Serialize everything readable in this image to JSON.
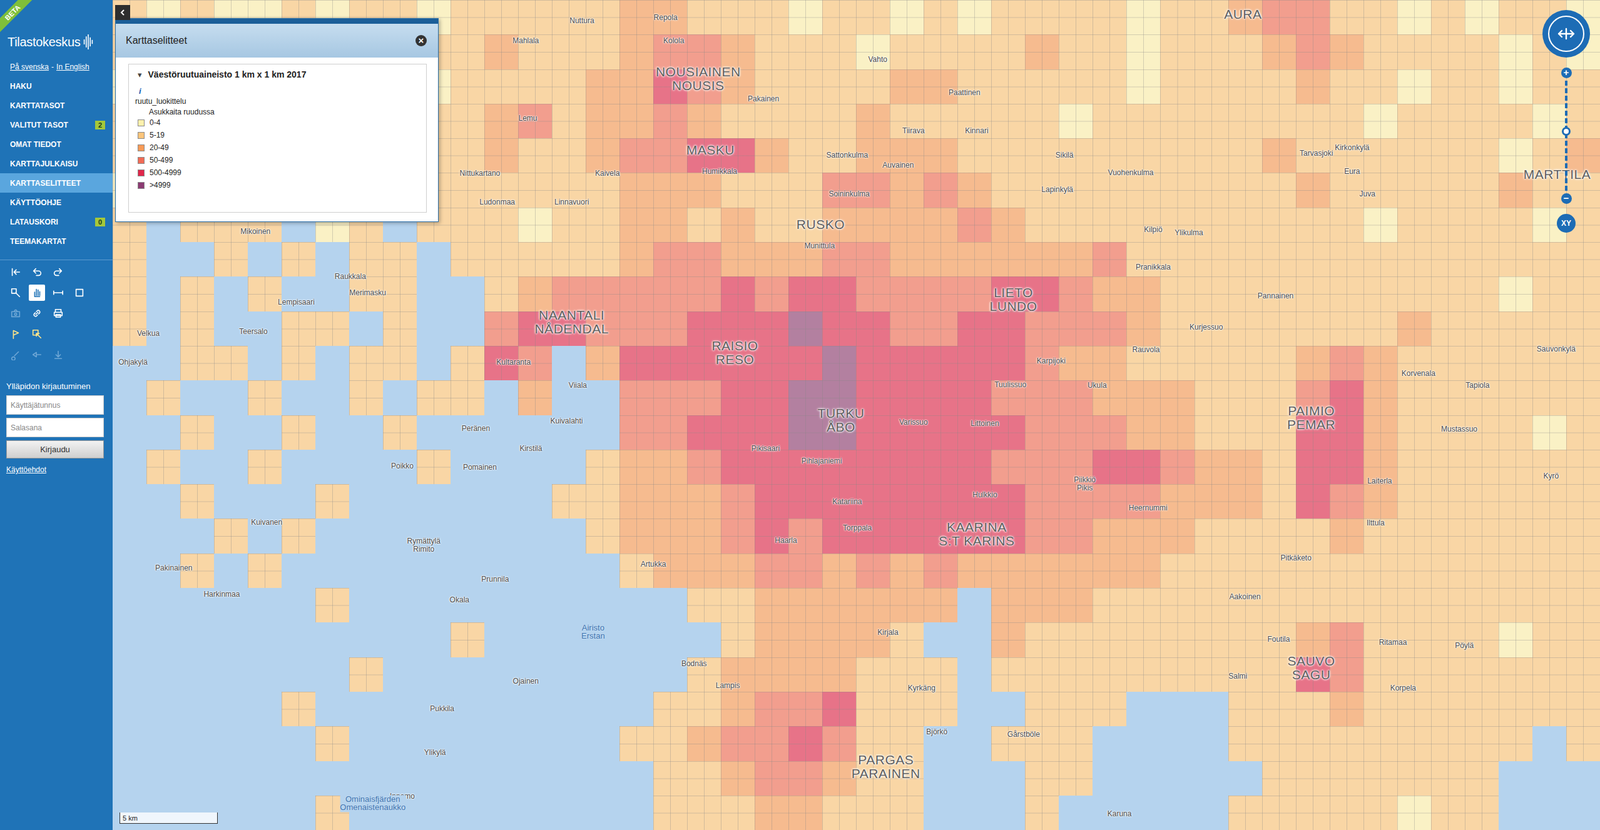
{
  "app": {
    "ribbon": "BETA",
    "logo": "Tilastokeskus"
  },
  "languages": {
    "links": [
      "På svenska",
      "In English"
    ],
    "separator": "-"
  },
  "menu": [
    {
      "label": "HAKU",
      "selected": false
    },
    {
      "label": "KARTTATASOT",
      "selected": false
    },
    {
      "label": "VALITUT TASOT",
      "selected": false,
      "badge": "2"
    },
    {
      "label": "OMAT TIEDOT",
      "selected": false
    },
    {
      "label": "KARTTAJULKAISU",
      "selected": false
    },
    {
      "label": "KARTTASELITTEET",
      "selected": true
    },
    {
      "label": "KÄYTTÖOHJE",
      "selected": false
    },
    {
      "label": "LATAUSKORI",
      "selected": false,
      "badge": "0"
    },
    {
      "label": "TEEMAKARTAT",
      "selected": false
    }
  ],
  "tools": [
    [
      {
        "selected": false,
        "disabled": false
      },
      {
        "selected": false,
        "disabled": false
      },
      {
        "selected": false,
        "disabled": false
      }
    ],
    [
      {
        "selected": false,
        "disabled": false
      },
      {
        "selected": true,
        "disabled": false
      },
      {
        "selected": false,
        "disabled": false
      },
      {
        "selected": false,
        "disabled": false
      }
    ],
    [
      {
        "selected": false,
        "disabled": true
      },
      {
        "selected": false,
        "disabled": false
      },
      {
        "selected": false,
        "disabled": false
      }
    ],
    [
      {
        "selected": false,
        "disabled": false
      },
      {
        "selected": false,
        "disabled": false
      }
    ],
    [
      {
        "selected": false,
        "disabled": true
      },
      {
        "selected": false,
        "disabled": true
      },
      {
        "selected": false,
        "disabled": true
      }
    ]
  ],
  "login": {
    "title": "Ylläpidon kirjautuminen",
    "username_placeholder": "Käyttäjätunnus",
    "password_placeholder": "Salasana",
    "button": "Kirjaudu",
    "terms": "Käyttöehdot"
  },
  "legend_panel": {
    "title": "Karttaselitteet",
    "close": "×",
    "layer": {
      "toggle": "▾",
      "title": "Väestöruutuaineisto 1 km x 1 km 2017",
      "expanded": true,
      "info": "i",
      "field": "ruutu_luokittelu",
      "caption": "Asukkaita ruudussa",
      "classes": [
        {
          "label": "0-4",
          "color": "#fff1ad"
        },
        {
          "label": "5-19",
          "color": "#fdc57a"
        },
        {
          "label": "20-49",
          "color": "#f99a56"
        },
        {
          "label": "50-499",
          "color": "#f26b55"
        },
        {
          "label": "500-4999",
          "color": "#e0264a"
        },
        {
          "label": ">4999",
          "color": "#8c3b72"
        }
      ]
    }
  },
  "grid": {
    "rows": [
      "10100101101111122111011010111101123311010110",
      "11011010111211123321110111121101112321111010",
      "01101101101111224321111221111101111211011011",
      "10110111111231223211112111110111111110111101",
      "11011011111211233442112221111111112111111012",
      "01101~~1111111122211133232111111111211111211",
      "1~111~01~11101122121122223211111111110111101",
      "1~~1~1~11~1111123322233222222311111111111111",
      "1~1~1~~11~~123333343443333443221111111111011",
      "1~1~~11~1~~344333444544334433321111111211111",
      "~~11~1~11~143~244444454444432211111232111111",
      "~1~~1~~1~11~2~~33344554444333222111342111111",
      "~~1~~1~~1~~~~~~33444554444433322111442111101",
      "~1~~1~~~~1~~~~122344444444333443221442111111",
      "~~1~~~1~~~~~~1122234444444433332221432111111",
      "~~~1~1~~~~~~~~122234344444433222111121111111",
      "~~1~1~~~~~~~~~~12223323232222221111111111111",
      "~~~~~~1~~~~~~~~~~11222222~222111111111111111",
      "~~~~~~~~~~1~~~~~~~122221~~211111111231111011",
      "~~~~~~~1~~~~~~~~~12222111~111111111431111111",
      "~~~~~1~~~~~~~~~~112334111~~111~~~11121111111",
      "~~~~~~1~~~~~~~~112334311~~111~~~~111111111~1",
      "~~~~~~~~~~~~~~~~11233211~~~11~~~~~1111111~~~",
      "~~~~~~1~~~~~~~~~11122111~~~1~~~~~11111011~~~"
    ]
  },
  "places": [
    {
      "lines": [
        "NOUSIAINEN",
        "NOUSIS"
      ],
      "kind": "municipality"
    },
    {
      "lines": [
        "MASKU"
      ],
      "kind": "municipality"
    },
    {
      "lines": [
        "RUSKO"
      ],
      "kind": "municipality"
    },
    {
      "lines": [
        "NAANTALI",
        "NÅDENDAL"
      ],
      "kind": "municipality"
    },
    {
      "lines": [
        "RAISIO",
        "RESO"
      ],
      "kind": "municipality"
    },
    {
      "lines": [
        "TURKU",
        "ÅBO"
      ],
      "kind": "municipality"
    },
    {
      "lines": [
        "LIETO",
        "LUNDO"
      ],
      "kind": "municipality"
    },
    {
      "lines": [
        "KAARINA",
        "S:T KARINS"
      ],
      "kind": "municipality"
    },
    {
      "lines": [
        "PAIMIO",
        "PEMAR"
      ],
      "kind": "municipality"
    },
    {
      "lines": [
        "SAUVO",
        "SAGU"
      ],
      "kind": "municipality"
    },
    {
      "lines": [
        "PARGAS",
        "PARAINEN"
      ],
      "kind": "municipality"
    },
    {
      "lines": [
        "AURA"
      ],
      "kind": "municipality"
    },
    {
      "lines": [
        "MARTTILA"
      ],
      "kind": "municipality"
    },
    {
      "lines": [
        "Nuttura"
      ],
      "kind": "village"
    },
    {
      "lines": [
        "Repola"
      ],
      "kind": "village"
    },
    {
      "lines": [
        "Kolola"
      ],
      "kind": "village"
    },
    {
      "lines": [
        "Mahlala"
      ],
      "kind": "village"
    },
    {
      "lines": [
        "Lemu"
      ],
      "kind": "village"
    },
    {
      "lines": [
        "Vahto"
      ],
      "kind": "village"
    },
    {
      "lines": [
        "Pakainen"
      ],
      "kind": "village"
    },
    {
      "lines": [
        "Paattinen"
      ],
      "kind": "village"
    },
    {
      "lines": [
        "Tiirava"
      ],
      "kind": "village"
    },
    {
      "lines": [
        "Kinnari"
      ],
      "kind": "village"
    },
    {
      "lines": [
        "Sattonkulma"
      ],
      "kind": "village"
    },
    {
      "lines": [
        "Auvainen"
      ],
      "kind": "village"
    },
    {
      "lines": [
        "Tarvasjoki"
      ],
      "kind": "village"
    },
    {
      "lines": [
        "Kirkonkylä"
      ],
      "kind": "village"
    },
    {
      "lines": [
        "Eura"
      ],
      "kind": "village"
    },
    {
      "lines": [
        "Juva"
      ],
      "kind": "village"
    },
    {
      "lines": [
        "Nittukartano"
      ],
      "kind": "village"
    },
    {
      "lines": [
        "Ludonmaa"
      ],
      "kind": "village"
    },
    {
      "lines": [
        "Linnavuori"
      ],
      "kind": "village"
    },
    {
      "lines": [
        "Kaivela"
      ],
      "kind": "village"
    },
    {
      "lines": [
        "Humikkala"
      ],
      "kind": "village"
    },
    {
      "lines": [
        "Soininkulma"
      ],
      "kind": "village"
    },
    {
      "lines": [
        "Munittula"
      ],
      "kind": "village"
    },
    {
      "lines": [
        "Mikoinen"
      ],
      "kind": "village"
    },
    {
      "lines": [
        "Raukkala"
      ],
      "kind": "village"
    },
    {
      "lines": [
        "Lempisaari"
      ],
      "kind": "village"
    },
    {
      "lines": [
        "Merimasku"
      ],
      "kind": "village"
    },
    {
      "lines": [
        "Teersalo"
      ],
      "kind": "village"
    },
    {
      "lines": [
        "Velkua"
      ],
      "kind": "village"
    },
    {
      "lines": [
        "Ohjakylä"
      ],
      "kind": "village"
    },
    {
      "lines": [
        "Kultaranta"
      ],
      "kind": "village"
    },
    {
      "lines": [
        "Viiala"
      ],
      "kind": "village"
    },
    {
      "lines": [
        "Kuivalahti"
      ],
      "kind": "village"
    },
    {
      "lines": [
        "Peränen"
      ],
      "kind": "village"
    },
    {
      "lines": [
        "Kirstilä"
      ],
      "kind": "village"
    },
    {
      "lines": [
        "Poikko"
      ],
      "kind": "village"
    },
    {
      "lines": [
        "Pomainen"
      ],
      "kind": "village"
    },
    {
      "lines": [
        "Kuivanen"
      ],
      "kind": "village"
    },
    {
      "lines": [
        "Rymättylä",
        "Rimito"
      ],
      "kind": "village"
    },
    {
      "lines": [
        "Pakinainen"
      ],
      "kind": "village"
    },
    {
      "lines": [
        "Harkinmaa"
      ],
      "kind": "village"
    },
    {
      "lines": [
        "Okala"
      ],
      "kind": "village"
    },
    {
      "lines": [
        "Prunnila"
      ],
      "kind": "village"
    },
    {
      "lines": [
        "Artukka"
      ],
      "kind": "village"
    },
    {
      "lines": [
        "Haarla"
      ],
      "kind": "village"
    },
    {
      "lines": [
        "Pikisaari"
      ],
      "kind": "village"
    },
    {
      "lines": [
        "Pihlajaniemi"
      ],
      "kind": "village"
    },
    {
      "lines": [
        "Katariina"
      ],
      "kind": "village"
    },
    {
      "lines": [
        "Torppala"
      ],
      "kind": "village"
    },
    {
      "lines": [
        "Varissuo"
      ],
      "kind": "village"
    },
    {
      "lines": [
        "Littoinen"
      ],
      "kind": "village"
    },
    {
      "lines": [
        "Hulkkio"
      ],
      "kind": "village"
    },
    {
      "lines": [
        "Piikkiö",
        "Pikis"
      ],
      "kind": "village"
    },
    {
      "lines": [
        "Heernummi"
      ],
      "kind": "village"
    },
    {
      "lines": [
        "Tuulissuo"
      ],
      "kind": "village"
    },
    {
      "lines": [
        "Karpijoki"
      ],
      "kind": "village"
    },
    {
      "lines": [
        "Ukula"
      ],
      "kind": "village"
    },
    {
      "lines": [
        "Rauvola"
      ],
      "kind": "village"
    },
    {
      "lines": [
        "Kurjessuo"
      ],
      "kind": "village"
    },
    {
      "lines": [
        "Pannainen"
      ],
      "kind": "village"
    },
    {
      "lines": [
        "Pranikkala"
      ],
      "kind": "village"
    },
    {
      "lines": [
        "Kilpiö"
      ],
      "kind": "village"
    },
    {
      "lines": [
        "Ylikulma"
      ],
      "kind": "village"
    },
    {
      "lines": [
        "Lapinkylä"
      ],
      "kind": "village"
    },
    {
      "lines": [
        "Sikilä"
      ],
      "kind": "village"
    },
    {
      "lines": [
        "Vuohenkulma"
      ],
      "kind": "village"
    },
    {
      "lines": [
        "Korvenala"
      ],
      "kind": "village"
    },
    {
      "lines": [
        "Tapiola"
      ],
      "kind": "village"
    },
    {
      "lines": [
        "Sauvonkylä"
      ],
      "kind": "village"
    },
    {
      "lines": [
        "Mustassuo"
      ],
      "kind": "village"
    },
    {
      "lines": [
        "Laiterla"
      ],
      "kind": "village"
    },
    {
      "lines": [
        "Kyrö"
      ],
      "kind": "village"
    },
    {
      "lines": [
        "Ilttula"
      ],
      "kind": "village"
    },
    {
      "lines": [
        "Pitkäketo"
      ],
      "kind": "village"
    },
    {
      "lines": [
        "Aakoinen"
      ],
      "kind": "village"
    },
    {
      "lines": [
        "Foutila"
      ],
      "kind": "village"
    },
    {
      "lines": [
        "Salmi"
      ],
      "kind": "village"
    },
    {
      "lines": [
        "Ritamaa"
      ],
      "kind": "village"
    },
    {
      "lines": [
        "Pöylä"
      ],
      "kind": "village"
    },
    {
      "lines": [
        "Korpela"
      ],
      "kind": "village"
    },
    {
      "lines": [
        "Kirjala"
      ],
      "kind": "village"
    },
    {
      "lines": [
        "Bodnäs"
      ],
      "kind": "village"
    },
    {
      "lines": [
        "Lampis"
      ],
      "kind": "village"
    },
    {
      "lines": [
        "Kyrkäng"
      ],
      "kind": "village"
    },
    {
      "lines": [
        "Björkö"
      ],
      "kind": "village"
    },
    {
      "lines": [
        "Gårstböle"
      ],
      "kind": "village"
    },
    {
      "lines": [
        "Ojainen"
      ],
      "kind": "village"
    },
    {
      "lines": [
        "Pukkila"
      ],
      "kind": "village"
    },
    {
      "lines": [
        "Ylikylä"
      ],
      "kind": "village"
    },
    {
      "lines": [
        "Innamo"
      ],
      "kind": "village"
    },
    {
      "lines": [
        "Karuna"
      ],
      "kind": "village"
    },
    {
      "lines": [
        "Airisto",
        "Erstan"
      ],
      "kind": "water"
    },
    {
      "lines": [
        "Ominaisfjärden",
        "Omenaistenaukko"
      ],
      "kind": "water"
    }
  ],
  "zoom": {
    "plus": "+",
    "minus": "−",
    "level": 0.54,
    "xy": "XY"
  },
  "scale": {
    "label": "5 km"
  }
}
